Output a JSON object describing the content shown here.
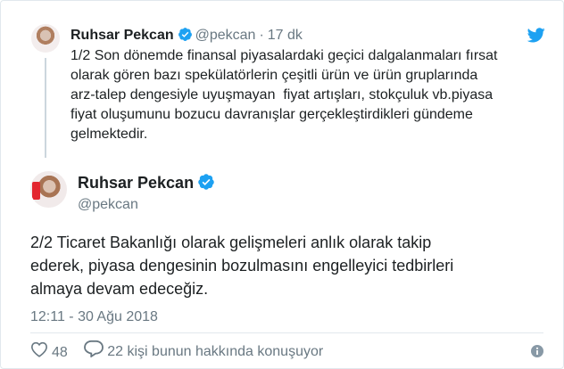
{
  "parent_tweet": {
    "name": "Ruhsar Pekcan",
    "handle": "@pekcan",
    "separator": "·",
    "time": "17 dk",
    "text": "1/2 Son dönemde finansal piyasalardaki geçici dalgalanmaları fırsat\nolarak gören bazı spekülatörlerin çeşitli ürün ve ürün gruplarında\narz-talep dengesiyle uyuşmayan  fiyat artışları, stokçuluk vb.piyasa\nfiyat oluşumunu bozucu davranışlar gerçekleştirdikleri gündeme\ngelmektedir."
  },
  "main_tweet": {
    "name": "Ruhsar Pekcan",
    "handle": "@pekcan",
    "text": "2/2 Ticaret Bakanlığı olarak gelişmeleri anlık olarak takip\nederek, piyasa dengesinin bozulmasını engelleyici tedbirleri\nalmaya devam edeceğiz.",
    "date": "12:11 - 30 Ağu 2018"
  },
  "actions": {
    "likes": "48",
    "replies": "22 kişi bunun hakkında konuşuyor"
  },
  "colors": {
    "twitter_blue": "#1da1f2",
    "muted_text": "#697882",
    "body_text": "#1c2022",
    "border": "#e1e8ed"
  },
  "icons": [
    "verified-badge-icon",
    "twitter-bird-icon",
    "heart-icon",
    "comment-icon",
    "info-icon"
  ]
}
